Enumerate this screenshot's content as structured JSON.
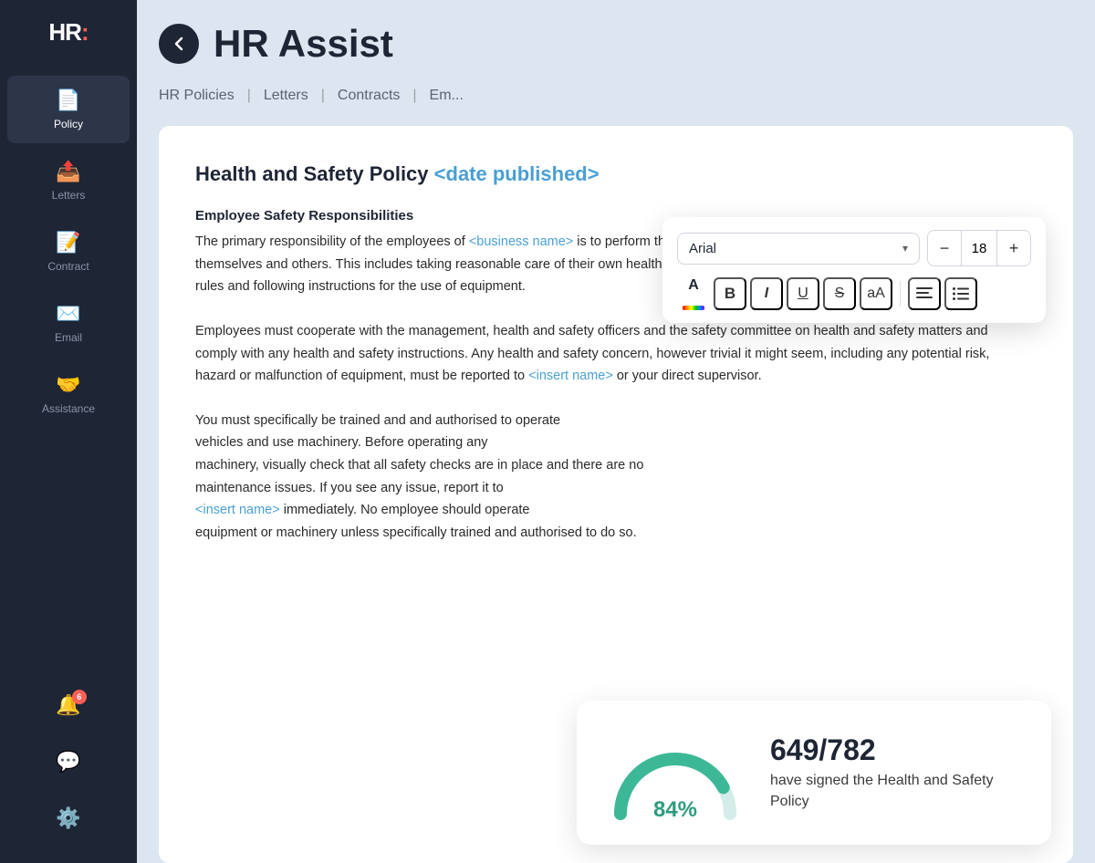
{
  "sidebar": {
    "logo": "HR:",
    "items": [
      {
        "id": "policy",
        "label": "Policy",
        "icon": "📄",
        "active": true
      },
      {
        "id": "letters",
        "label": "Letters",
        "icon": "📤"
      },
      {
        "id": "contract",
        "label": "Contract",
        "icon": "📝"
      },
      {
        "id": "email",
        "label": "Email",
        "icon": "✉️"
      },
      {
        "id": "assistance",
        "label": "Assistance",
        "icon": "🤝"
      }
    ],
    "notification_count": "6",
    "bottom_icons": [
      {
        "id": "bell",
        "icon": "🔔"
      },
      {
        "id": "chat",
        "icon": "💬"
      },
      {
        "id": "settings",
        "icon": "⚙️"
      }
    ]
  },
  "header": {
    "title": "HR Assist"
  },
  "nav": {
    "tabs": [
      "HR Policies",
      "Letters",
      "Contracts",
      "Em..."
    ]
  },
  "document": {
    "title": "Health and Safety Policy",
    "title_placeholder": "<date published>",
    "section1_title": "Employee Safety Responsibilities",
    "section1_para1_before": "The primary responsibility of the employees of ",
    "section1_business_placeholder": "<business name>",
    "section1_para1_after": " is to perform their duties in a safe manner in order to prevent injury to themselves and others. This includes taking reasonable care of their own health and safety and that of others by observing applicable safety rules and following instructions for the use of equipment.",
    "section1_para2": "Employees must cooperate with the management, health and safety officers and the safety committee on health and safety matters and comply with any health and safety instructions. Any health and safety concern, however trivial it might seem, including any potential risk, hazard or malfunction of equipment, must be reported to ",
    "section1_insert_name": "<insert name>",
    "section1_para2_after": " or your direct supervisor.",
    "section1_para3_before": "You must specifically be trained and a",
    "section1_para3_middle": "vehicles and use machinery. Before op",
    "section1_para3_cont": "machinery, visually check that all safe",
    "section1_para3_more": "maintenance issues. If you see any iss",
    "section1_insert_name2": "<insert name>",
    "section1_para3_end": " immediately. No emplo",
    "section1_para3_final": "equipment or machinery unless specifically trained and authorised to do so."
  },
  "toolbar": {
    "font_name": "Arial",
    "font_size": "18",
    "buttons": [
      {
        "id": "color",
        "label": "A",
        "type": "color"
      },
      {
        "id": "bold",
        "label": "B",
        "type": "bold"
      },
      {
        "id": "italic",
        "label": "I",
        "type": "italic"
      },
      {
        "id": "underline",
        "label": "U",
        "type": "underline"
      },
      {
        "id": "strikethrough",
        "label": "S",
        "type": "strikethrough"
      },
      {
        "id": "case",
        "label": "aA",
        "type": "case"
      }
    ],
    "align_label": "≡",
    "list_label": "≔",
    "minus_label": "−",
    "plus_label": "+"
  },
  "stats_card": {
    "percentage": "84%",
    "count": "649/782",
    "description": "have signed the Health and Safety Policy",
    "gauge_color": "#3db897",
    "gauge_bg_color": "#d5ede8"
  }
}
